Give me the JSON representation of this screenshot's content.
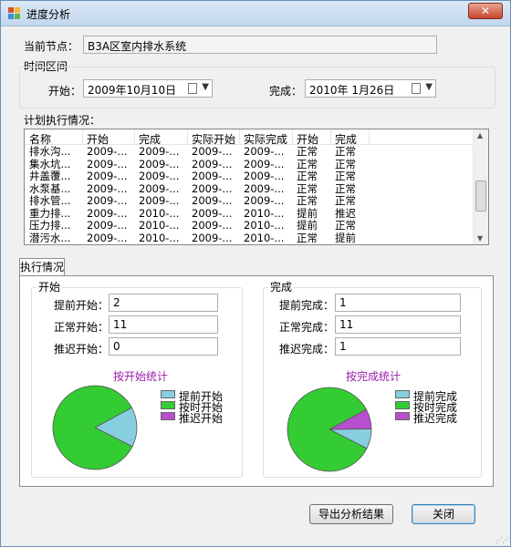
{
  "window": {
    "title": "进度分析",
    "close_glyph": "✕"
  },
  "node": {
    "label": "当前节点：",
    "value": "B3A区室内排水系统"
  },
  "time": {
    "group_label": "时间区间",
    "start_label": "开始：",
    "start_value": "2009年10月10日",
    "end_label": "完成：",
    "end_value": "2010年 1月26日"
  },
  "plan": {
    "label": "计划执行情况：",
    "columns": [
      "名称",
      "开始",
      "完成",
      "实际开始",
      "实际完成",
      "开始",
      "完成"
    ],
    "rows": [
      [
        "排水沟...",
        "2009-...",
        "2009-...",
        "2009-...",
        "2009-...",
        "正常",
        "正常"
      ],
      [
        "集水坑...",
        "2009-...",
        "2009-...",
        "2009-...",
        "2009-...",
        "正常",
        "正常"
      ],
      [
        "井盖覆...",
        "2009-...",
        "2009-...",
        "2009-...",
        "2009-...",
        "正常",
        "正常"
      ],
      [
        "水泵基...",
        "2009-...",
        "2009-...",
        "2009-...",
        "2009-...",
        "正常",
        "正常"
      ],
      [
        "排水管...",
        "2009-...",
        "2009-...",
        "2009-...",
        "2009-...",
        "正常",
        "正常"
      ],
      [
        "重力排...",
        "2009-...",
        "2010-...",
        "2009-...",
        "2010-...",
        "提前",
        "推迟"
      ],
      [
        "压力排...",
        "2009-...",
        "2010-...",
        "2009-...",
        "2010-...",
        "提前",
        "正常"
      ],
      [
        "潜污水...",
        "2009-...",
        "2010-...",
        "2009-...",
        "2010-...",
        "正常",
        "提前"
      ]
    ]
  },
  "tab": {
    "label": "执行情况"
  },
  "start_group": {
    "label": "开始",
    "early_label": "提前开始：",
    "early_value": "2",
    "normal_label": "正常开始：",
    "normal_value": "11",
    "late_label": "推迟开始：",
    "late_value": "0"
  },
  "end_group": {
    "label": "完成",
    "early_label": "提前完成：",
    "early_value": "1",
    "normal_label": "正常完成：",
    "normal_value": "11",
    "late_label": "推迟完成：",
    "late_value": "1"
  },
  "colors": {
    "early": "#87cee0",
    "normal": "#33cc33",
    "late": "#b84fcf"
  },
  "chart_data": [
    {
      "type": "pie",
      "title": "按开始统计",
      "categories": [
        "提前开始",
        "按时开始",
        "推迟开始"
      ],
      "values": [
        2,
        11,
        0
      ],
      "legend": "right"
    },
    {
      "type": "pie",
      "title": "按完成统计",
      "categories": [
        "提前完成",
        "按时完成",
        "推迟完成"
      ],
      "values": [
        1,
        11,
        1
      ],
      "legend": "right"
    }
  ],
  "buttons": {
    "export": "导出分析结果",
    "close": "关闭"
  }
}
